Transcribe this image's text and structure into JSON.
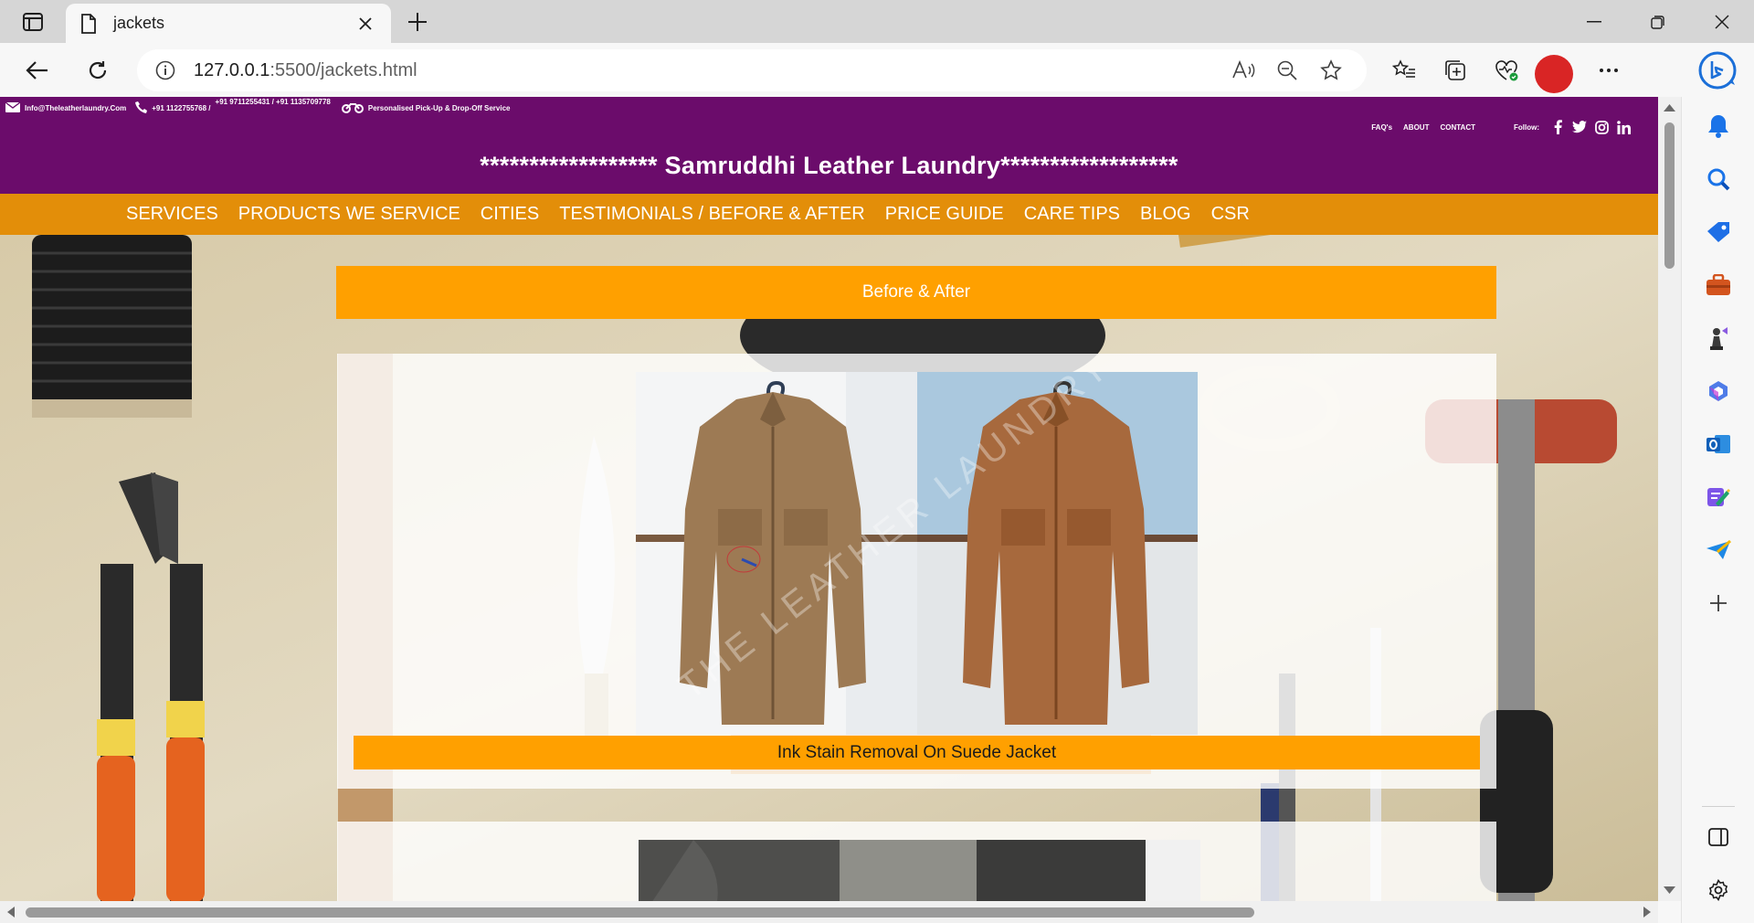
{
  "browser": {
    "tab_title": "jackets",
    "url_host": "127.0.0.1",
    "url_path": ":5500/jackets.html"
  },
  "site": {
    "contact": {
      "email": "Info@Theleatherlaundry.Com",
      "phone1": "+91 1122755768 /",
      "phone2": "+91 9711255431 / +91 1135709778",
      "service": "Personalised Pick-Up & Drop-Off Service"
    },
    "top_links": [
      "FAQ's",
      "ABOUT",
      "CONTACT"
    ],
    "follow_label": "Follow:",
    "brand": "****************** Samruddhi Leather Laundry******************",
    "nav": [
      "SERVICES",
      "PRODUCTS WE SERVICE",
      "CITIES",
      "TESTIMONIALS / BEFORE & AFTER",
      "PRICE GUIDE",
      "CARE TIPS",
      "BLOG",
      "CSR"
    ],
    "section_title": "Before & After",
    "caption1": "Ink Stain Removal On Suede Jacket",
    "watermark": "THE LEATHER LAUNDRY"
  },
  "colors": {
    "topbar": "#6b0c6b",
    "navbar": "#e38e09",
    "accent": "#ffa000"
  }
}
